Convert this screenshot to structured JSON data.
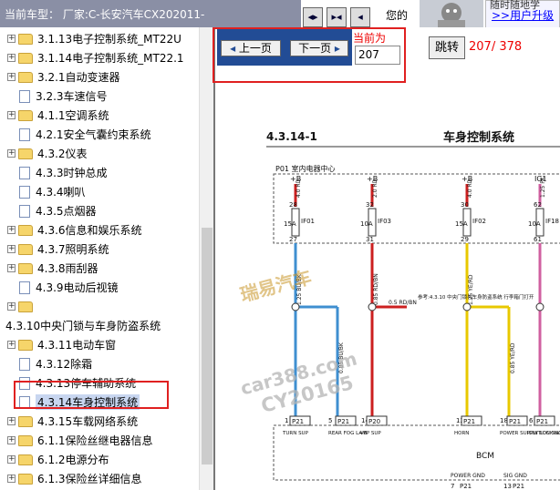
{
  "header": {
    "current_model_label": "当前车型：",
    "current_model_value": "厂家:C-长安汽车CX202011-",
    "nav_icons": [
      "◂▸",
      "▸◂",
      "◂"
    ],
    "now_text": "您的",
    "user_top": "随时随地学",
    "user_link": ">>用户升级"
  },
  "sidebar": {
    "items": [
      {
        "label": "3.1.13电子控制系统_MT22U",
        "icon": "folder",
        "expander": "+"
      },
      {
        "label": "3.1.14电子控制系统_MT22.1",
        "icon": "folder",
        "expander": "+"
      },
      {
        "label": "3.2.1自动变速器",
        "icon": "folder",
        "expander": "+"
      },
      {
        "label": "3.2.3车速信号",
        "icon": "doc",
        "expander": ""
      },
      {
        "label": "4.1.1空调系统",
        "icon": "folder",
        "expander": "+"
      },
      {
        "label": "4.2.1安全气囊约束系统",
        "icon": "doc",
        "expander": ""
      },
      {
        "label": "4.3.2仪表",
        "icon": "folder",
        "expander": "+"
      },
      {
        "label": "4.3.3时钟总成",
        "icon": "doc",
        "expander": ""
      },
      {
        "label": "4.3.4喇叭",
        "icon": "doc",
        "expander": ""
      },
      {
        "label": "4.3.5点烟器",
        "icon": "doc",
        "expander": ""
      },
      {
        "label": "4.3.6信息和娱乐系统",
        "icon": "folder",
        "expander": "+"
      },
      {
        "label": "4.3.7照明系统",
        "icon": "folder",
        "expander": "+"
      },
      {
        "label": "4.3.8雨刮器",
        "icon": "folder",
        "expander": "+"
      },
      {
        "label": "4.3.9电动后视镜",
        "icon": "doc",
        "expander": ""
      },
      {
        "label": "",
        "icon": "folder",
        "expander": "+"
      },
      {
        "label": "4.3.10中央门锁与车身防盗系统",
        "icon": "none",
        "expander": ""
      },
      {
        "label": "4.3.11电动车窗",
        "icon": "folder",
        "expander": "+"
      },
      {
        "label": "4.3.12除霜",
        "icon": "doc",
        "expander": ""
      },
      {
        "label": "4.3.13停车辅助系统",
        "icon": "doc",
        "expander": ""
      },
      {
        "label": "4.3.14车身控制系统",
        "icon": "doc",
        "expander": "",
        "selected": true
      },
      {
        "label": "4.3.15车载网络系统",
        "icon": "folder",
        "expander": "+"
      },
      {
        "label": "6.1.1保险丝继电器信息",
        "icon": "folder",
        "expander": "+"
      },
      {
        "label": "6.1.2电源分布",
        "icon": "folder",
        "expander": "+"
      },
      {
        "label": "6.1.3保险丝详细信息",
        "icon": "folder",
        "expander": "+"
      }
    ]
  },
  "pager": {
    "prev_label": "上一页",
    "next_label": "下一页",
    "prev_arrow": "◂",
    "next_arrow": "▸",
    "current_label": "当前为",
    "current_value": "207",
    "jump_label": "跳转",
    "page_count": "207/ 378"
  },
  "diagram": {
    "section": "4.3.14-1",
    "title": "车身控制系统",
    "subtitle": "P01 室内电器中心",
    "fuses": [
      {
        "top": "+B",
        "pin_in": "28",
        "pin_out": "27",
        "rating": "15A",
        "id": "IF01",
        "wire_in": "4.0 RD",
        "wire_out": "1.25 BU/BK",
        "color": "#cc2020",
        "out_color": "#3f8fd0",
        "connector": "P21",
        "conn_pin": "1",
        "label": "TURN SUP"
      },
      {
        "top": "+B",
        "pin_in": "32",
        "pin_out": "31",
        "rating": "10A",
        "id": "IF03",
        "wire_in": "2.0 RD",
        "wire_out": "0.85 RD/BN",
        "color": "#cc2020",
        "out_color": "#cc2020",
        "connector": "P20",
        "conn_pin": "14",
        "label": "+B"
      },
      {
        "top": "+B",
        "pin_in": "30",
        "pin_out": "29",
        "rating": "15A",
        "id": "IF02",
        "wire_in": "4.0 RD",
        "wire_out": "1.25 YE/RD",
        "color": "#cc2020",
        "out_color": "#e8c800",
        "connector": "P21",
        "conn_pin": "12",
        "label": "HORN"
      },
      {
        "top": "IG1",
        "pin_in": "62",
        "pin_out": "61",
        "rating": "10A",
        "id": "IF18",
        "wire_in": "1.25 PK",
        "wire_out": "",
        "color": "#d060a0",
        "out_color": "#d060a0",
        "connector": "P21",
        "conn_pin": "6",
        "label": "IGNITION SW"
      }
    ],
    "extra_connectors": [
      {
        "connector": "P21",
        "conn_pin": "5",
        "label": "REAR FOG LAMP SUP",
        "wire": "0.85 BU/BK"
      },
      {
        "connector": "P21",
        "conn_pin": "18",
        "label": "POWER SUPPLY LOCKING",
        "wire": "0.85 YE/RD"
      }
    ],
    "ref_note": "参考:4.3.10 中央门锁与车身防盗系统 行李箱门打开",
    "splice_wire": "0.5 RD/BN",
    "module": "BCM",
    "power_gnd": "POWER GND",
    "sig_gnd": "SIG GND",
    "gnd_pins": [
      {
        "connector": "P21",
        "conn_pin": "7"
      },
      {
        "connector": "P21",
        "conn_pin": "13"
      }
    ],
    "watermarks": [
      "瑞易汽车",
      "car388.com",
      "CY20165"
    ]
  }
}
